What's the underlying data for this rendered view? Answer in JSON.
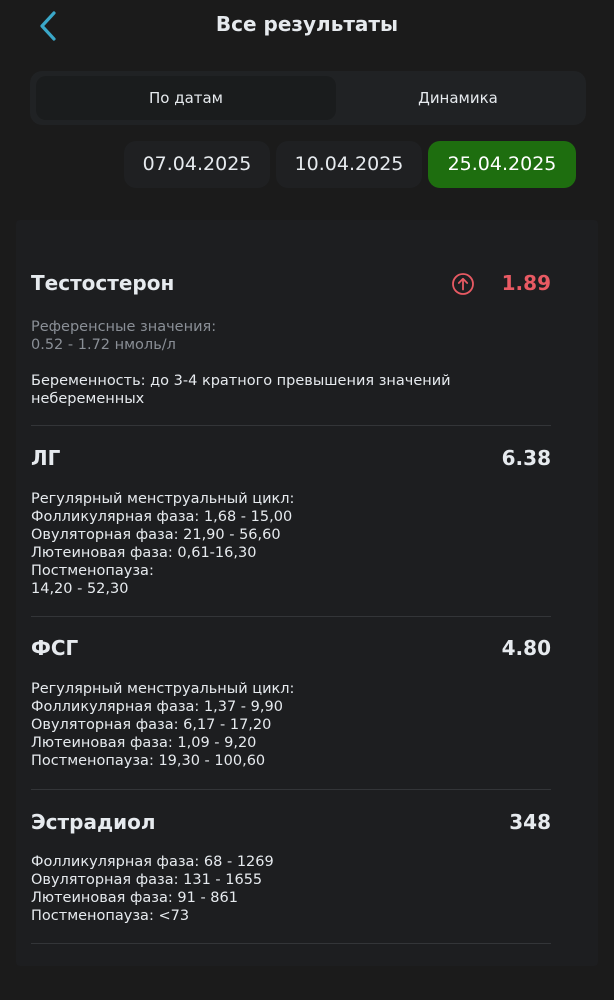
{
  "header": {
    "title": "Все результаты",
    "back_icon": "chevron-left-icon",
    "accent": "#3aa7c8"
  },
  "tabs": [
    {
      "label": "По датам",
      "active": true
    },
    {
      "label": "Динамика",
      "active": false
    }
  ],
  "dates": [
    {
      "label": "07.04.2025",
      "selected": false
    },
    {
      "label": "10.04.2025",
      "selected": false
    },
    {
      "label": "25.04.2025",
      "selected": true
    }
  ],
  "results": [
    {
      "name": "Тестостерон",
      "value": "1.89",
      "flag": "high",
      "flag_icon": "arrow-up-circle-icon",
      "flag_color": "#e85a63",
      "reference_label": "Референсные значения:\n0.52 - 1.72 нмоль/л",
      "note": "Беременность: до 3-4 кратного превышения значений\nнебеременных"
    },
    {
      "name": "ЛГ",
      "value": "6.38",
      "note": "Регулярный менструальный цикл:\nФолликулярная фаза: 1,68 - 15,00\nОвуляторная фаза: 21,90 - 56,60\nЛютеиновая фаза: 0,61-16,30\nПостменопауза:\n14,20 - 52,30"
    },
    {
      "name": "ФСГ",
      "value": "4.80",
      "note": "Регулярный менструальный цикл:\nФолликулярная фаза: 1,37 - 9,90\nОвуляторная фаза: 6,17 - 17,20\nЛютеиновая фаза: 1,09 - 9,20\nПостменопауза: 19,30 - 100,60"
    },
    {
      "name": "Эстрадиол",
      "value": "348",
      "note": "Фолликулярная фаза: 68 - 1269\nОвуляторная фаза: 131 - 1655\nЛютеиновая фаза: 91 - 861\nПостменопауза: <73"
    }
  ],
  "colors": {
    "background": "#1b1b1b",
    "selected_date": "#1e6e0f",
    "high_value": "#e85a63"
  }
}
